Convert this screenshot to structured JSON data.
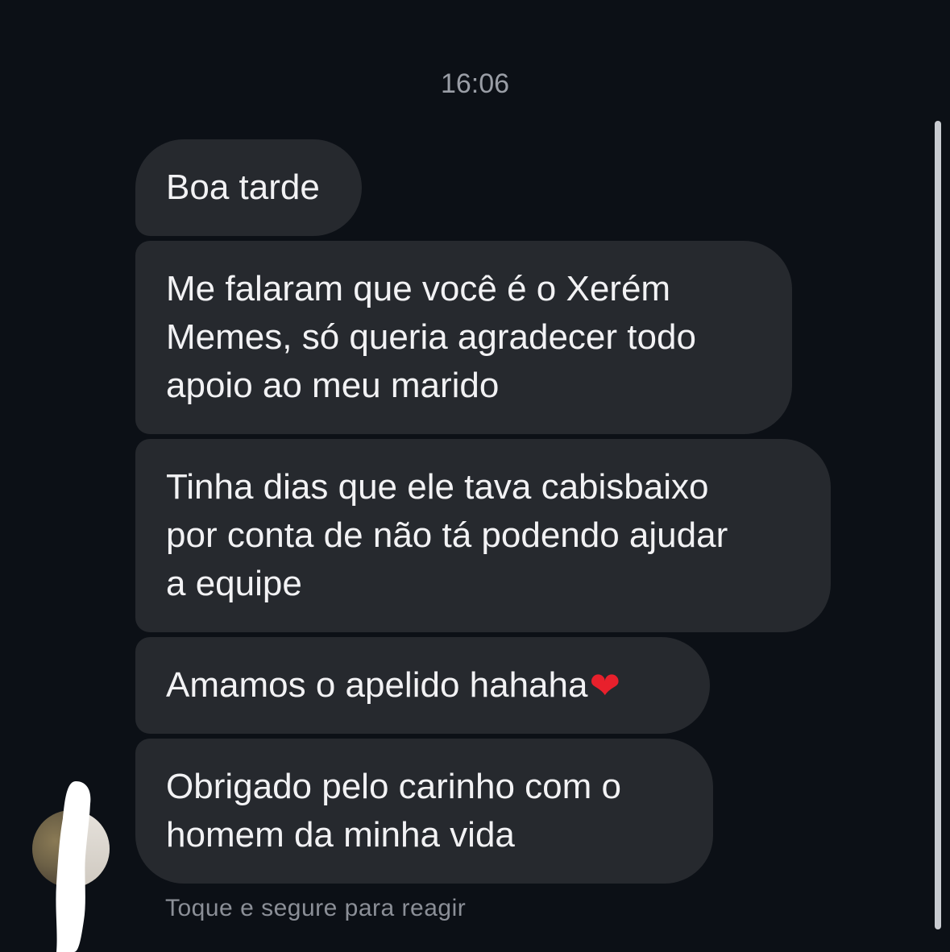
{
  "conversation": {
    "timestamp": "16:06",
    "messages": [
      {
        "text": "Boa tarde"
      },
      {
        "text": "Me falaram que você é o Xerém\nMemes, só queria agradecer todo\napoio ao meu marido"
      },
      {
        "text": "Tinha dias que ele tava cabisbaixo\npor conta de não tá podendo ajudar\na equipe"
      },
      {
        "text": "Amamos o apelido hahaha",
        "emoji": "❤"
      },
      {
        "text": "Obrigado pelo carinho com o\nhomem da minha vida"
      }
    ],
    "reaction_hint": "Toque e segure para reagir"
  },
  "icons": {
    "heart": "red-heart-emoji"
  },
  "colors": {
    "background": "#0c1016",
    "bubble": "#26292e",
    "text": "#f2f2f4",
    "secondary_text": "#9a9ea6"
  }
}
